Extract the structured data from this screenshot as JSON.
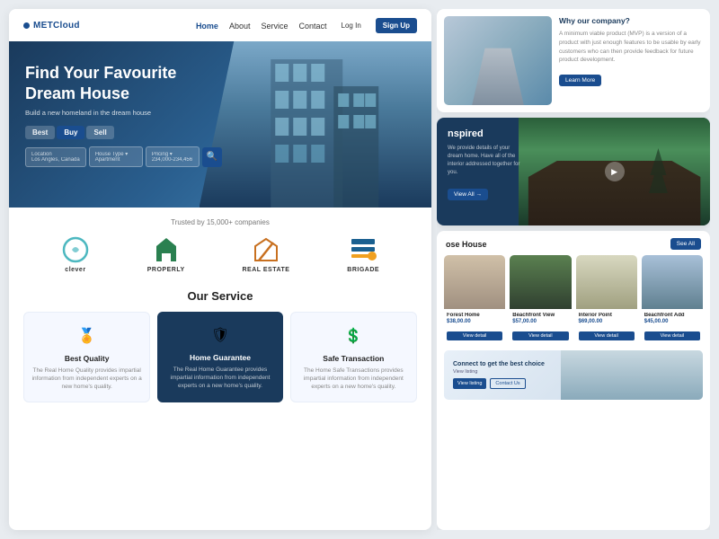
{
  "site": {
    "logo": "METCloud",
    "nav": {
      "links": [
        "Home",
        "About",
        "Service",
        "Contact"
      ],
      "active": "Home",
      "login": "Log In",
      "signup": "Sign Up"
    }
  },
  "hero": {
    "title": "Find Your Favourite Dream House",
    "subtitle": "Build a new homeland in the dream house",
    "tabs": [
      "Best",
      "Buy",
      "Sell"
    ],
    "active_tab": "Buy",
    "search": {
      "location_label": "Location",
      "location_sub": "Los Angles, Canada",
      "house_type_label": "House Type ▾",
      "house_type_sub": "Apartment",
      "pricing_label": "Pricing ▾",
      "pricing_sub": "234,000-234,456"
    }
  },
  "trusted": {
    "label": "Trusted by 15,000+ companies",
    "brands": [
      {
        "name": "clever",
        "color": "#4db8c0"
      },
      {
        "name": "PROPERLY",
        "color": "#2a8050"
      },
      {
        "name": "REAL ESTATE",
        "color": "#c87020"
      },
      {
        "name": "BRIGADE",
        "color": "#1a6090"
      }
    ]
  },
  "services": {
    "title": "Our Service",
    "items": [
      {
        "icon": "🏅",
        "title": "Best Quality",
        "desc": "The Real Home Quality provides impartial information from independent experts on a new home's quality.",
        "dark": false
      },
      {
        "icon": "🛡",
        "title": "Home Guarantee",
        "desc": "The Real Home Guarantee provides impartial information from independent experts on a new home's quality.",
        "dark": true
      },
      {
        "icon": "💲",
        "title": "Safe Transaction",
        "desc": "The Home Safe Transactions provides impartial information from independent experts on a new home's quality.",
        "dark": false
      }
    ]
  },
  "why": {
    "title": "Why our company?",
    "text": "A minimum viable product (MVP) is a version of a product with just enough features to be usable by early customers who can then provide feedback for future product development.",
    "btn": "Learn More"
  },
  "inspired": {
    "title": "nspired",
    "text": "We provide details of your dream home. Have all of the interior addressed together for you.",
    "btn": "View All →"
  },
  "choose": {
    "title": "ose House",
    "btn": "See All",
    "houses": [
      {
        "name": "Forest Home",
        "price": "$38,00.00",
        "btn": "View detail"
      },
      {
        "name": "Beachfront View",
        "price": "$57,00.00",
        "btn": "View detail"
      },
      {
        "name": "Interior Point",
        "price": "$69,00.00",
        "btn": "View detail"
      },
      {
        "name": "Beachfront Add",
        "price": "$45,00.00",
        "btn": "View detail"
      }
    ]
  },
  "interior": {
    "title": "Connect to get the best choice",
    "subtitle": "View listing",
    "btn_primary": "View listing",
    "btn_outline": "Contact Us"
  }
}
